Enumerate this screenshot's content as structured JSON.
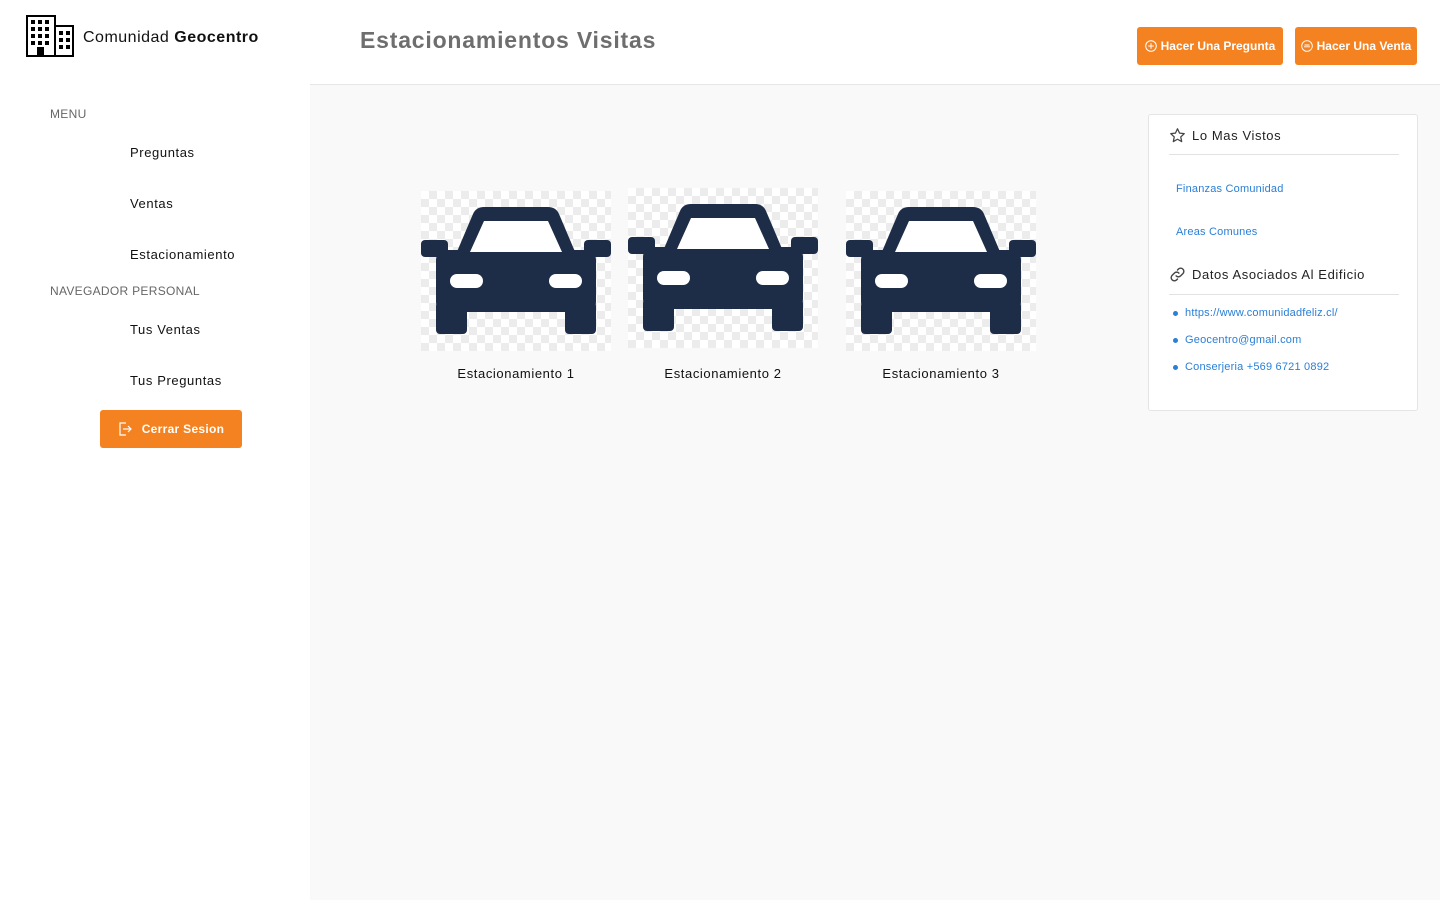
{
  "brand": {
    "prefix": "Comunidad",
    "name": "Geocentro",
    "icon": "building-icon"
  },
  "sidebar": {
    "menu_label": "MENU",
    "menu_items": [
      {
        "label": "Preguntas"
      },
      {
        "label": "Ventas"
      },
      {
        "label": "Estacionamiento"
      }
    ],
    "personal_label": "NAVEGADOR PERSONAL",
    "personal_items": [
      {
        "label": "Tus Ventas"
      },
      {
        "label": "Tus Preguntas"
      }
    ],
    "logout": {
      "label": "Cerrar Sesion",
      "icon": "logout-icon"
    }
  },
  "header": {
    "title": "Estacionamientos Visitas",
    "ask_button": {
      "label": "Hacer Una Pregunta",
      "icon": "plus-circle-icon"
    },
    "sell_button": {
      "label": "Hacer Una Venta",
      "icon": "sale-tag-icon"
    }
  },
  "parking": {
    "cards": [
      {
        "label": "Estacionamiento 1",
        "icon": "car-icon"
      },
      {
        "label": "Estacionamiento 2",
        "icon": "car-icon"
      },
      {
        "label": "Estacionamiento 3",
        "icon": "car-icon"
      }
    ]
  },
  "panel": {
    "most_viewed": {
      "title": "Lo Mas Vistos",
      "icon": "star-icon",
      "links": [
        "Finanzas Comunidad",
        "Areas Comunes"
      ]
    },
    "building_data": {
      "title": "Datos Asociados Al Edificio",
      "icon": "link-icon",
      "links": [
        "https://www.comunidadfeliz.cl/",
        "Geocentro@gmail.com",
        "Conserjeria +569 6721 0892"
      ]
    }
  },
  "colors": {
    "accent": "#f58220",
    "car": "#1e2d47",
    "link": "#2a7fd6",
    "title": "#6e6e6e"
  }
}
